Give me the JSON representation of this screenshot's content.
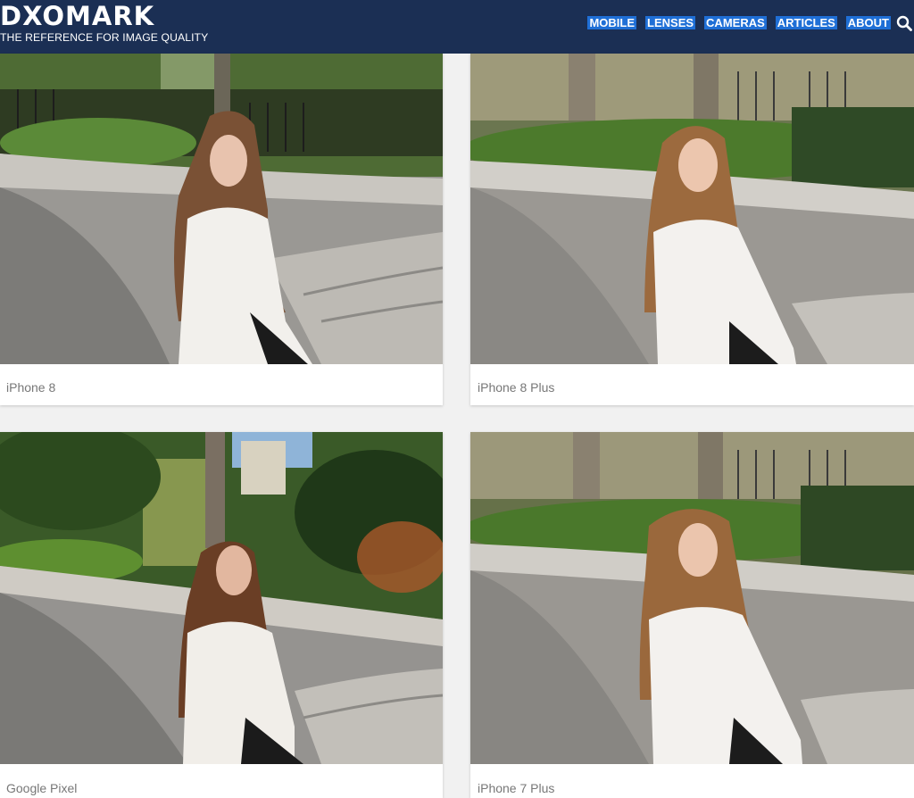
{
  "header": {
    "logo": "DXOMARK",
    "tagline": "THE REFERENCE FOR IMAGE QUALITY",
    "nav": [
      "MOBILE",
      "LENSES",
      "CAMERAS",
      "ARTICLES",
      "ABOUT"
    ],
    "search_icon": "search-icon",
    "colors": {
      "background": "#1b2f54",
      "nav_highlight": "#1f6fd6",
      "text": "#ffffff"
    }
  },
  "gallery": [
    {
      "caption": "iPhone 8"
    },
    {
      "caption": "iPhone 8 Plus"
    },
    {
      "caption": "Google Pixel"
    },
    {
      "caption": "iPhone 7 Plus"
    }
  ]
}
